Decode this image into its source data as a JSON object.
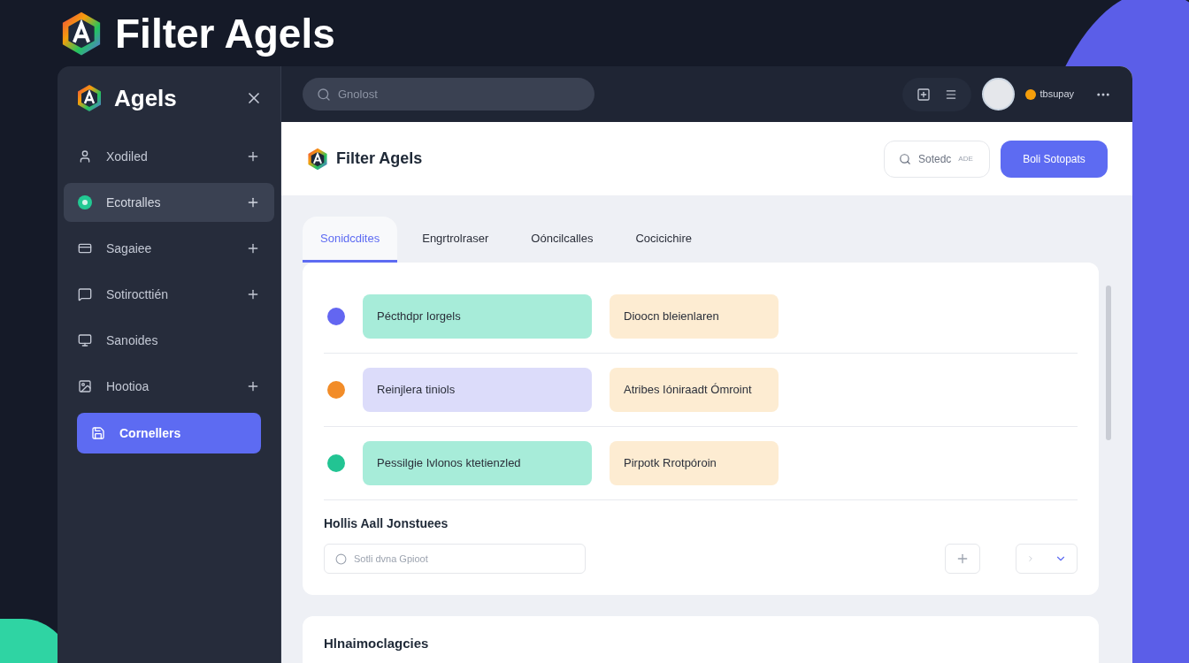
{
  "hero": {
    "title": "Filter Agels"
  },
  "sidebar": {
    "brand": "Agels",
    "items": [
      {
        "label": "Xodiled",
        "expandable": true,
        "hovered": false,
        "selected": false
      },
      {
        "label": "Ecotralles",
        "expandable": true,
        "hovered": true,
        "selected": false
      },
      {
        "label": "Sagaiee",
        "expandable": true,
        "hovered": false,
        "selected": false
      },
      {
        "label": "Sotirocttién",
        "expandable": true,
        "hovered": false,
        "selected": false
      },
      {
        "label": "Sanoides",
        "expandable": false,
        "hovered": false,
        "selected": false
      },
      {
        "label": "Hootioa",
        "expandable": true,
        "hovered": false,
        "selected": false
      },
      {
        "label": "Cornellers",
        "expandable": false,
        "hovered": false,
        "selected": true
      }
    ]
  },
  "topbar": {
    "search_placeholder": "Gnolost",
    "user": "tbsupay"
  },
  "page": {
    "title": "Filter Agels",
    "search": {
      "placeholder": "Sotedc",
      "shortcut": "ADE"
    },
    "primary_button": "Boli Sotopats"
  },
  "tabs": [
    {
      "label": "Sonidcdites",
      "selected": true
    },
    {
      "label": "Engrtrolraser",
      "selected": false
    },
    {
      "label": "Oóncilcalles",
      "selected": false
    },
    {
      "label": "Cocicichire",
      "selected": false
    }
  ],
  "rows": [
    {
      "color": "#6366f1",
      "chips": [
        {
          "text": "Pécthdpr Iorgels",
          "color": "#a7ecd9"
        },
        {
          "text": "Dioocn bleienlaren",
          "color": "#fdecd2"
        }
      ]
    },
    {
      "color": "#f28c28",
      "chips": [
        {
          "text": "Reinjlera tiniols",
          "color": "#dcdcfa"
        },
        {
          "text": "Atribes Ióniraadt Ómroint",
          "color": "#fdecd2"
        }
      ]
    },
    {
      "color": "#22c493",
      "chips": [
        {
          "text": "Pessilgie Ivlonos ktetienzled",
          "color": "#a7ecd9"
        },
        {
          "text": "Pirpotk Rrotpóroin",
          "color": "#fdecd2"
        }
      ]
    }
  ],
  "section": {
    "title": "Hollis Aall Jonstuees",
    "field_placeholder": "Sotli dvna Gpioot"
  },
  "card2": {
    "title": "Hlnaimoclagcies"
  }
}
